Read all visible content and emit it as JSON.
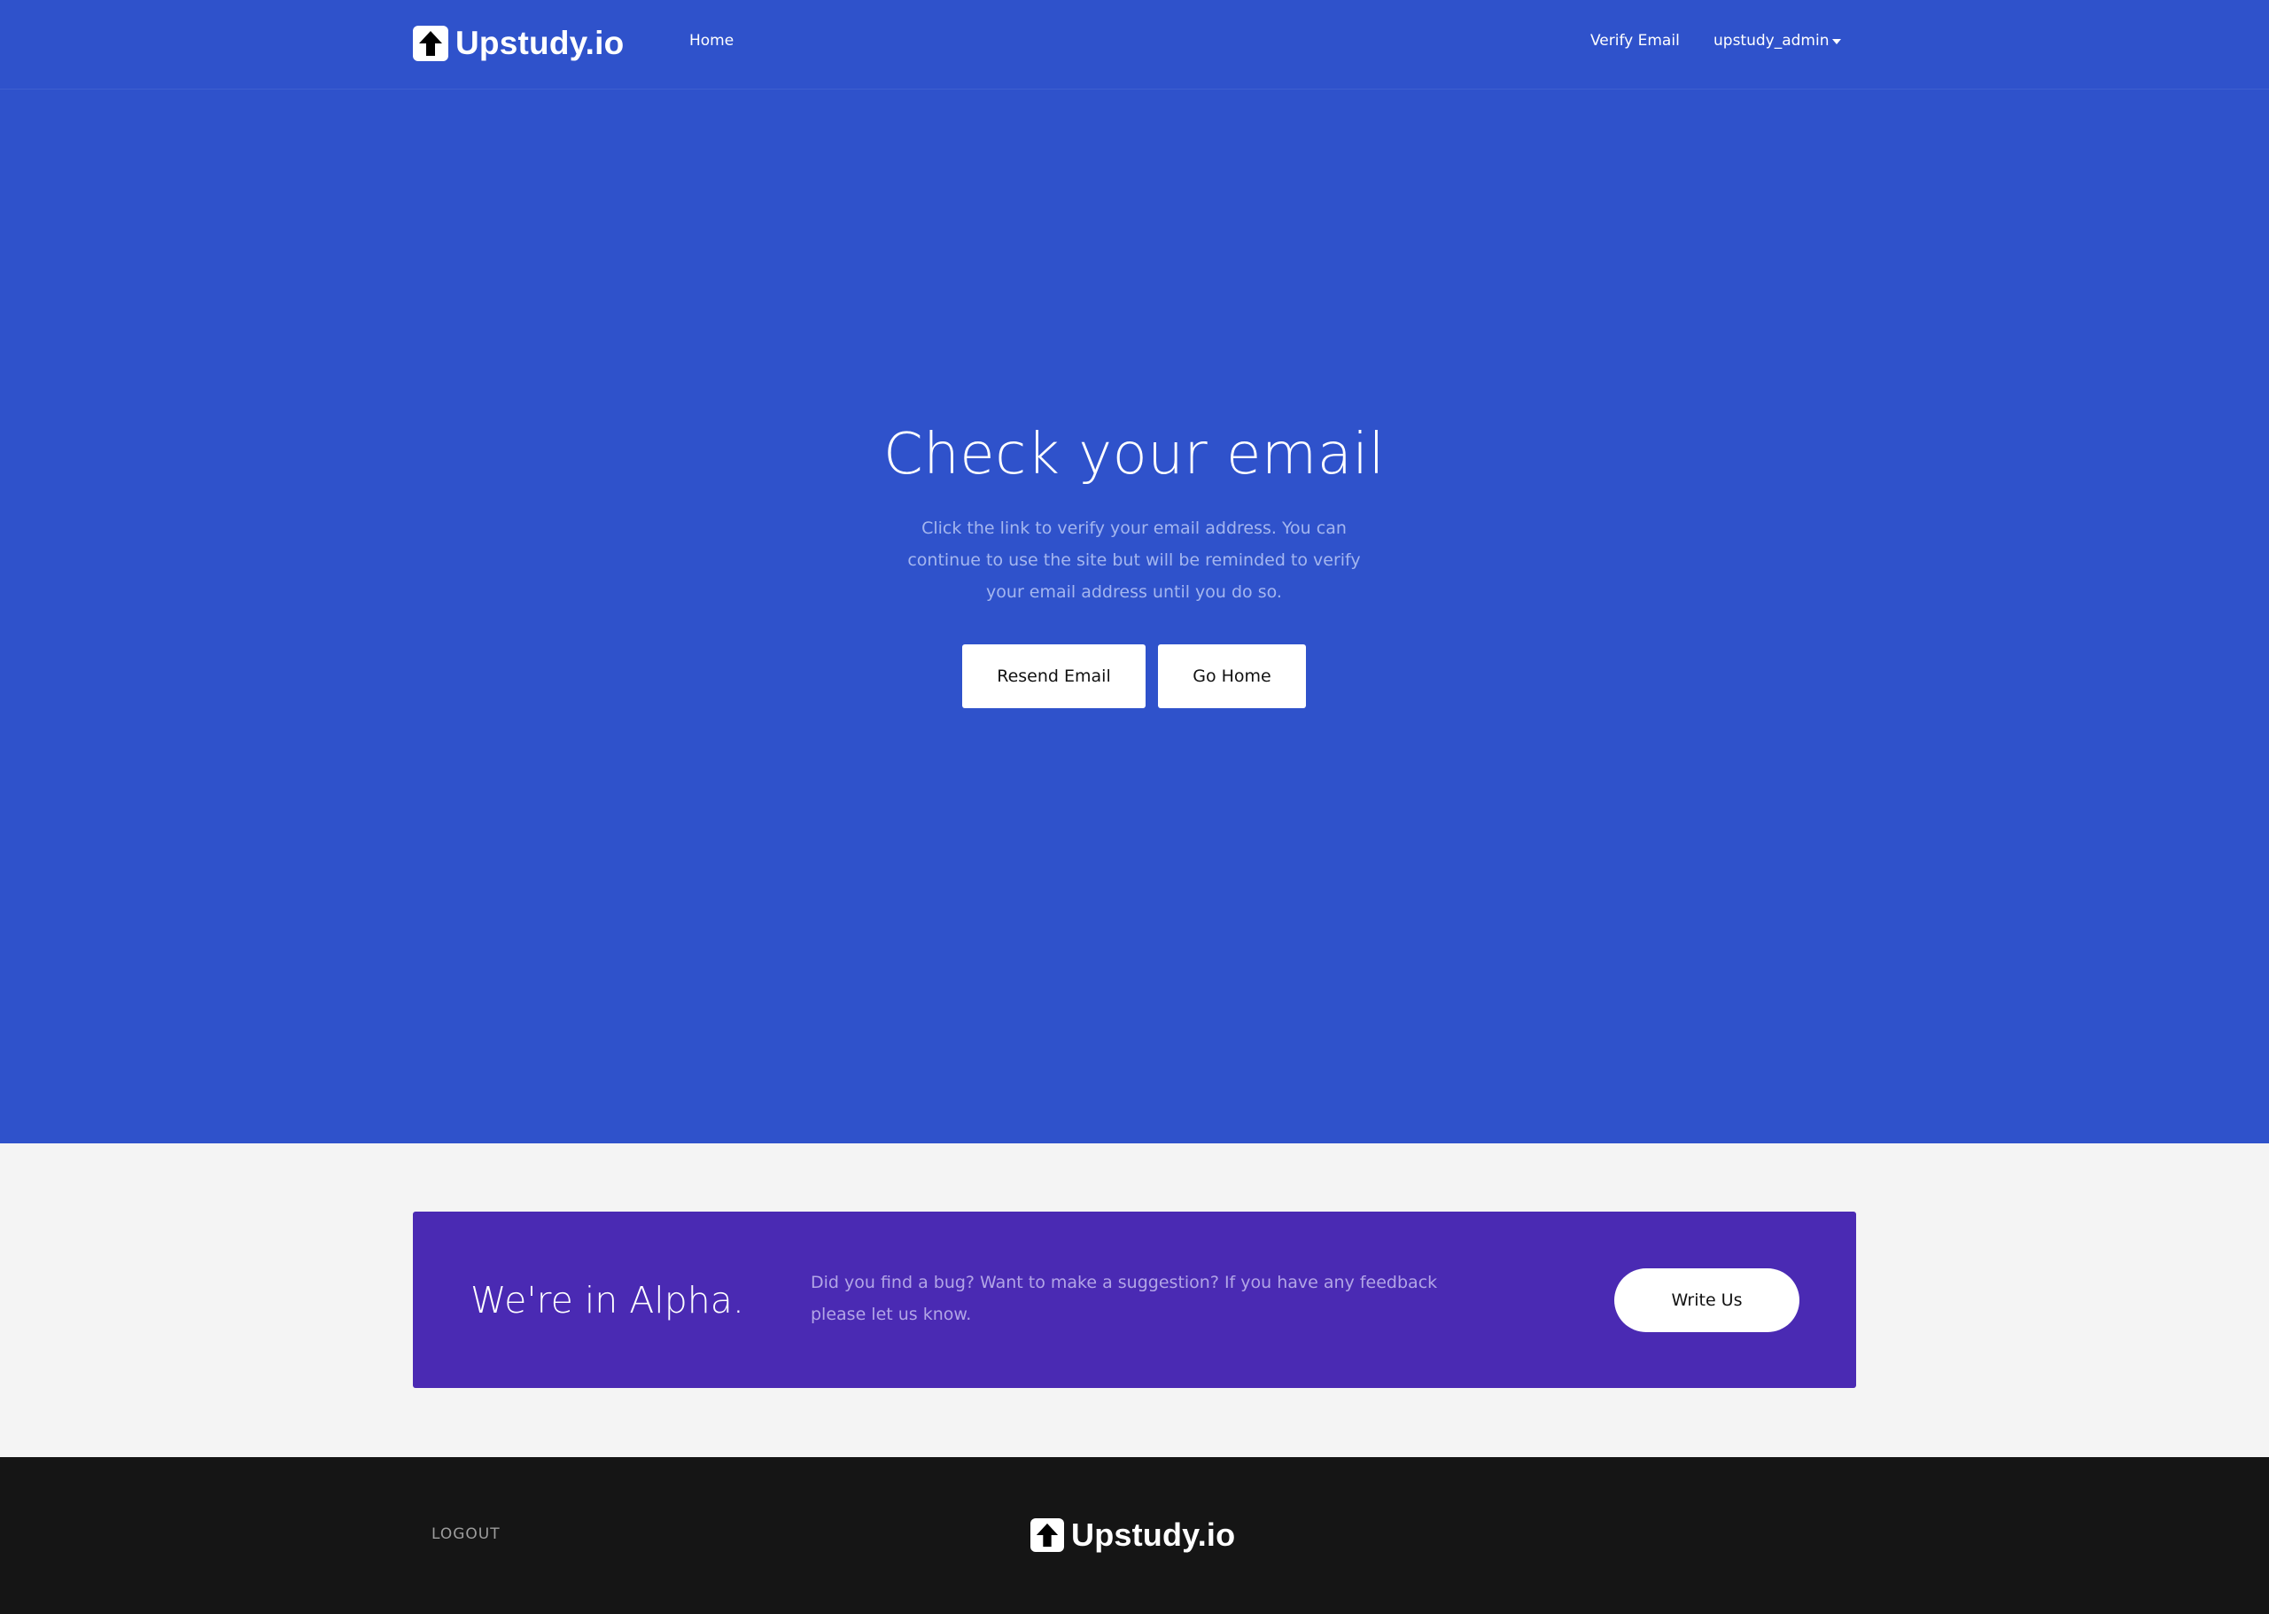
{
  "navbar": {
    "brand": "Upstudy.io",
    "brand_icon": "arrow-up-icon",
    "links": {
      "home": "Home",
      "verify_email": "Verify Email",
      "user": "upstudy_admin"
    }
  },
  "hero": {
    "title": "Check your email",
    "text": "Click the link to verify your email address. You can continue to use the site but will be reminded to verify your email address until you do so.",
    "buttons": {
      "resend": "Resend Email",
      "home": "Go Home"
    }
  },
  "alpha_banner": {
    "title": "We're in Alpha.",
    "text": "Did you find a bug? Want to make a suggestion? If you have any feedback please let us know.",
    "button": "Write Us"
  },
  "footer": {
    "logout": "LOGOUT",
    "brand": "Upstudy.io"
  },
  "colors": {
    "hero_bg": "#2f52cb",
    "alpha_bg": "#4a2ab3",
    "footer_bg": "#151515",
    "page_bg": "#f4f4f4"
  }
}
